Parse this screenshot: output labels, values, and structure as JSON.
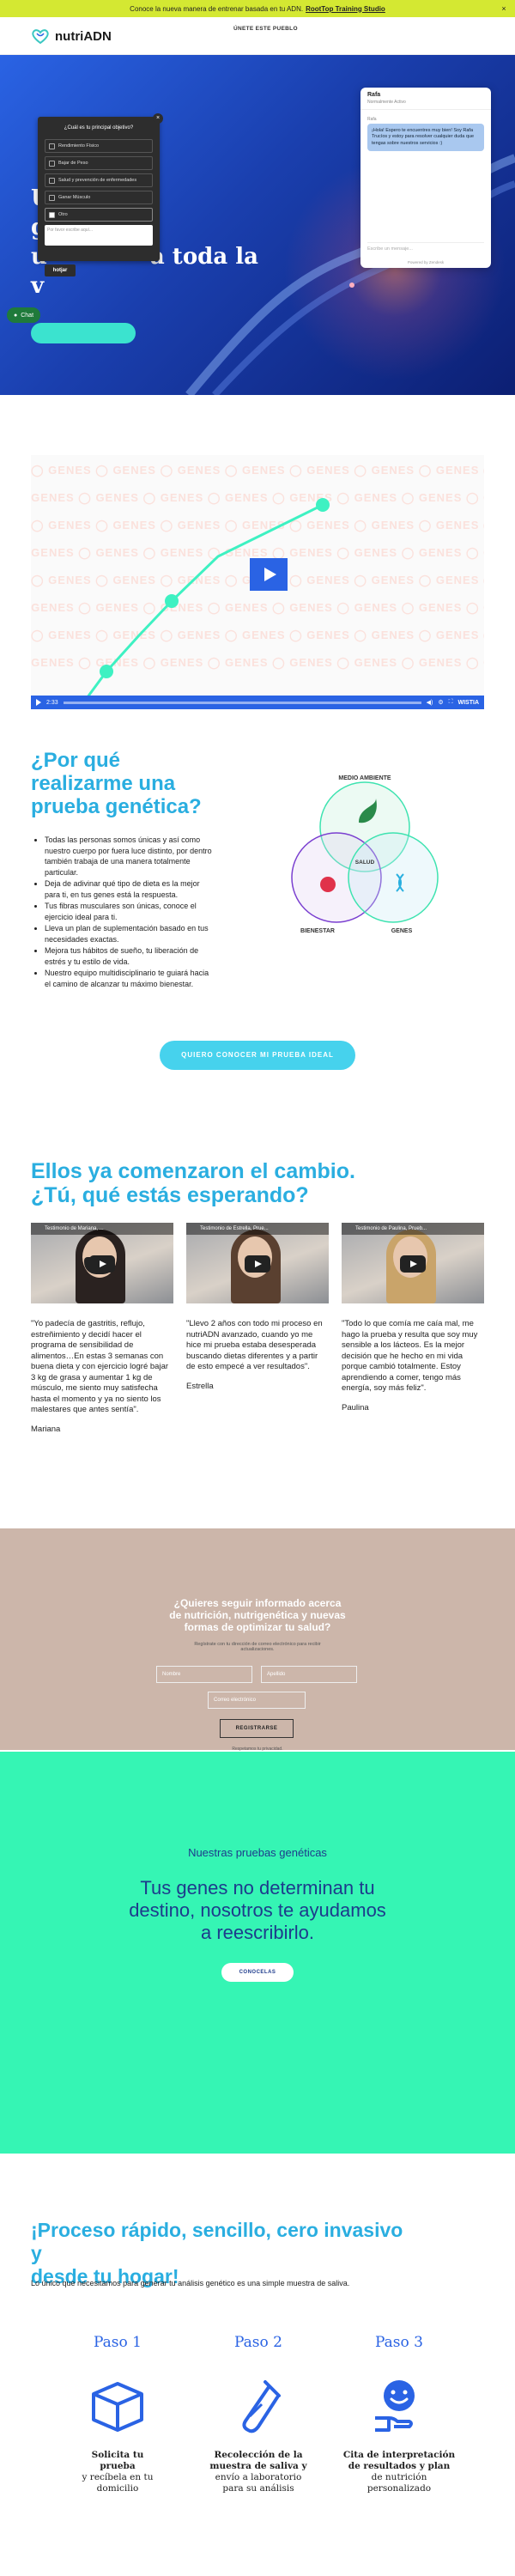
{
  "promo": {
    "text": "Conoce la nueva manera de entrenar basada en tu ADN.",
    "link": "RootTop Training Studio",
    "close": "×"
  },
  "brand": {
    "name": "nutriADN"
  },
  "nav": [
    "ÚNETE ESTE PUEBLO"
  ],
  "hero": {
    "line1": "U",
    "line2": "g",
    "line3a": "u",
    "line3b": "a toda la",
    "line4": "v"
  },
  "survey": {
    "question": "¿Cuál es tu principal objetivo?",
    "options": [
      "Rendimiento Físico",
      "Bajar de Peso",
      "Salud y prevención de enfermedades",
      "Ganar Músculo",
      "Otro"
    ],
    "other_placeholder": "Por favor escribe aquí...",
    "close": "×",
    "brand": "hotjar"
  },
  "chat_pill": "Chat",
  "chat": {
    "name": "Rafa",
    "status": "Normalmente Activo",
    "label": "Rafa",
    "message": "¡Hola! Espero te encuentres muy bien! Soy Rafa Trucíos y estoy para resolver cualquier duda que tengas sobre nuestros servicios :)",
    "input_placeholder": "Escribe un mensaje...",
    "footer": "Powered by Zendesk"
  },
  "video": {
    "watermark": "GENES",
    "time": "2:33",
    "brand": "WISTIA"
  },
  "why": {
    "title_lines": [
      "¿Por qué",
      "realizarme una",
      "prueba genética?"
    ],
    "items": [
      "Todas las personas somos únicas y así como nuestro cuerpo por fuera luce distinto, por dentro también trabaja de una manera totalmente particular.",
      "Deja de adivinar qué tipo de dieta es la mejor para ti, en tus genes está la respuesta.",
      "Tus fibras musculares son únicas, conoce el ejercicio ideal para ti.",
      "Lleva un plan de suplementación basado en tus necesidades exactas.",
      "Mejora tus hábitos de sueño, tu liberación de estrés y tu estilo de vida.",
      "Nuestro equipo multidisciplinario te guiará hacia el camino de alcanzar tu máximo bienestar."
    ],
    "venn": {
      "top": "MEDIO AMBIENTE",
      "left": "BIENESTAR",
      "right": "GENES",
      "center": "SALUD"
    }
  },
  "cta_ideal": "QUIERO CONOCER MI PRUEBA IDEAL",
  "change": {
    "title_lines": [
      "Ellos ya comenzaron el cambio.",
      "¿Tú, qué estás esperando?"
    ],
    "testimonials": [
      {
        "caption": "Testimonio de Mariana, ...",
        "quote": "\"Yo padecía de gastritis, reflujo, estreñimiento y decidí hacer el programa de sensibilidad de alimentos…En estas 3 semanas con buena dieta y con ejercicio logré bajar 3 kg de grasa y aumentar 1 kg de músculo, me siento muy satisfecha hasta el momento y ya no siento los malestares que antes sentía\".",
        "author": "Mariana"
      },
      {
        "caption": "Testimonio de Estrella, Prue...",
        "quote": "\"Llevo 2 años con todo mi proceso en nutriADN avanzado, cuando yo me hice mi prueba estaba desesperada buscando dietas diferentes y a partir de esto empecé a ver resultados\".",
        "author": "Estrella"
      },
      {
        "caption": "Testimonio de Paulina, Prueb...",
        "quote": "\"Todo lo que comía me caía mal, me hago la prueba y resulta que soy muy sensible a los lácteos. Es la mejor decisión que he hecho en mi vida porque cambió totalmente. Estoy aprendiendo a comer, tengo más energía, soy más feliz\".",
        "author": "Paulina"
      }
    ]
  },
  "newsletter": {
    "title_lines": [
      "¿Quieres seguir informado acerca",
      "de nutrición, nutrigenética y nuevas",
      "formas de optimizar tu salud?"
    ],
    "subtitle": "Regístrate con tu dirección de correo electrónico para recibir actualizaciones.",
    "first_name": "Nombre",
    "last_name": "Apellido",
    "email": "Correo electrónico",
    "button": "REGISTRARSE",
    "privacy": "Respetamos tu privacidad."
  },
  "tests": {
    "small": "Nuestras pruebas genéticas",
    "big_lines": [
      "Tus genes no determinan tu",
      "destino, nosotros te ayudamos",
      "a reescribirlo."
    ],
    "button": "CONOCELAS"
  },
  "process": {
    "title_lines": [
      "¡Proceso rápido, sencillo, cero invasivo y",
      "desde tu hogar!"
    ],
    "subtitle": "Lo único que necesitamos para generar tu análisis genético es una simple muestra de saliva.",
    "steps": [
      {
        "title": "Paso 1",
        "desc": [
          "Solicita tu",
          "prueba",
          "y recíbela en tu",
          "domicilio"
        ],
        "icon": "box-icon"
      },
      {
        "title": "Paso 2",
        "desc": [
          "Recolección de la",
          "muestra de saliva y",
          "envío a laboratorio",
          "para su análisis"
        ],
        "icon": "test-tube-icon"
      },
      {
        "title": "Paso 3",
        "desc": [
          "Cita de interpretación",
          "de resultados y plan",
          "de nutrición",
          "personalizado"
        ],
        "icon": "happy-hand-icon"
      }
    ]
  },
  "colors": {
    "accent_blue": "#2aaee0",
    "brand_blue": "#2a63e4",
    "mint": "#35f5b4",
    "promo_yellow": "#d4e832",
    "cta_cyan": "#46d2ed"
  }
}
